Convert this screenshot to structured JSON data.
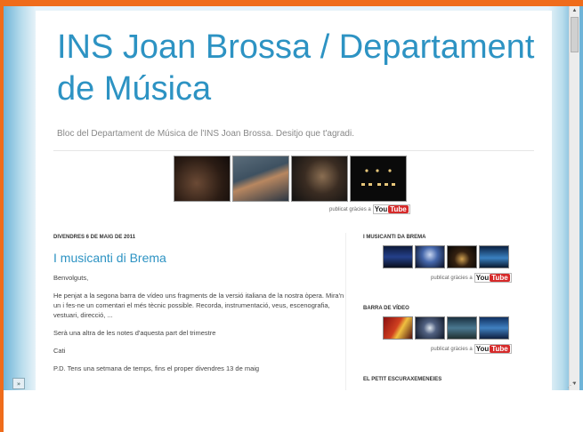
{
  "blog": {
    "title": "INS Joan Brossa / Departament de Música",
    "description": "Bloc del Departament de Música de l'INS Joan Brossa. Desitjo que t'agradi."
  },
  "header_credit": {
    "text": "publicat gràcies a",
    "you": "You",
    "tube": "Tube"
  },
  "post": {
    "date": "DIVENDRES 6 DE MAIG DE 2011",
    "title": "I musicanti di Brema",
    "greeting": "Benvolguts,",
    "paragraph1": "He penjat a la segona barra de vídeo uns fragments de la versió italiana de la nostra òpera. Mira'n un i fes-ne un comentari el més tècnic possible. Recorda, instrumentació, veus, escenografia, vestuari, direcció, ...",
    "paragraph2": "Serà una altra de les notes d'aquesta part del trimestre",
    "signature": "Cati",
    "postscript": "P.D. Tens una setmana de temps, fins el proper divendres 13 de maig"
  },
  "sidebar": {
    "widget1_title": "I MUSICANTI DA BREMA",
    "widget1_credit": "publicat gràcies a",
    "widget2_title": "BARRA DE VÍDEO",
    "widget2_credit": "publicat gràcies a",
    "widget3_title": "EL PETIT ESCURAXEMENEIES"
  },
  "chrome": {
    "expand_glyph": "»",
    "scroll_up": "▲",
    "scroll_down": "▼",
    "resize_glyph": "⋰"
  },
  "colors": {
    "frame_accent": "#ef6c1b",
    "title_blue": "#2d93c3",
    "youtube_red": "#d62a2a"
  }
}
